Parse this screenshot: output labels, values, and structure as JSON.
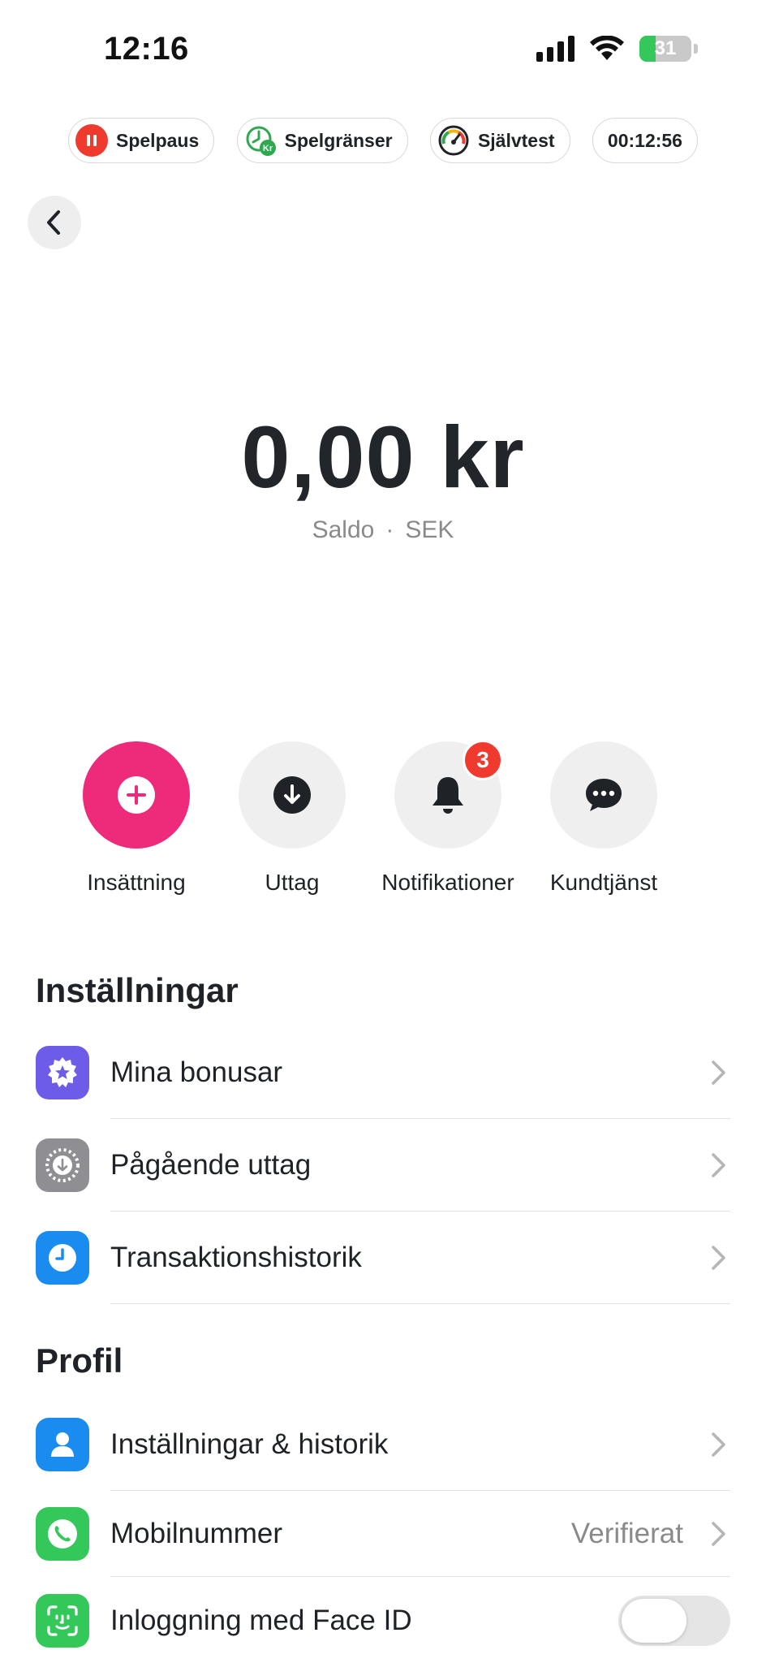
{
  "status_bar": {
    "time": "12:16",
    "battery": "31"
  },
  "chips": {
    "pause": "Spelpaus",
    "limits": "Spelgränser",
    "limits_icon_text": "Kr",
    "selftest": "Självtest",
    "timer": "00:12:56"
  },
  "balance": {
    "amount": "0,00 kr",
    "label": "Saldo",
    "separator": "·",
    "currency": "SEK"
  },
  "actions": [
    {
      "label": "Insättning"
    },
    {
      "label": "Uttag"
    },
    {
      "label": "Notifikationer",
      "badge": "3"
    },
    {
      "label": "Kundtjänst"
    }
  ],
  "settings": {
    "title": "Inställningar",
    "items": [
      {
        "label": "Mina bonusar"
      },
      {
        "label": "Pågående uttag"
      },
      {
        "label": "Transaktionshistorik"
      }
    ]
  },
  "profile": {
    "title": "Profil",
    "items": [
      {
        "label": "Inställningar & historik"
      },
      {
        "label": "Mobilnummer",
        "value": "Verifierat"
      },
      {
        "label": "Inloggning med Face ID",
        "toggle_on": false
      }
    ]
  },
  "colors": {
    "primary": "#ee2a7b",
    "badge": "#f13a2f",
    "bonus_icon": "#6d5ce8",
    "withdrawal_icon": "#8e8e93",
    "history_icon": "#1a8cf0",
    "profile_icon": "#1a8cf0",
    "phone_icon": "#34c759",
    "faceid_icon": "#34c759"
  }
}
